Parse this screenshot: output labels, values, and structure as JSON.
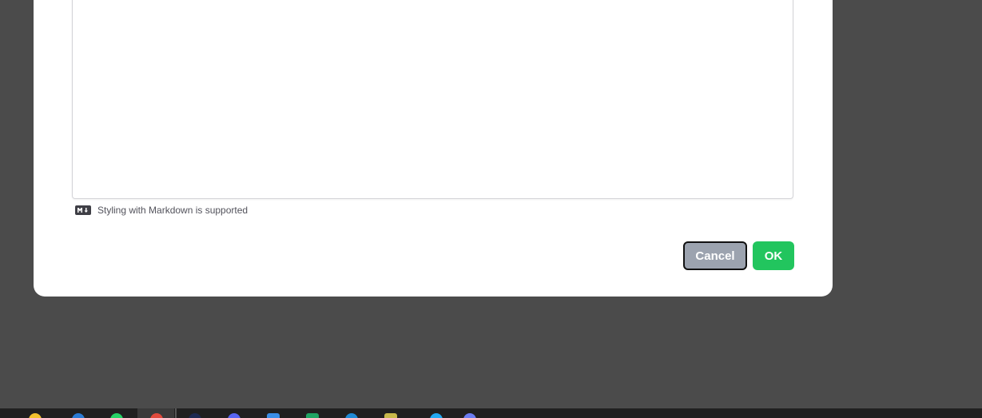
{
  "dialog": {
    "markdown_hint": "Styling with Markdown is supported",
    "cancel_label": "Cancel",
    "ok_label": "OK"
  },
  "colors": {
    "backdrop": "#4b4b4b",
    "cancel_button": "#9ca3af",
    "ok_button": "#22c55e",
    "taskbar": "#202020"
  },
  "taskbar": {
    "icons": [
      {
        "name": "file-explorer-icon",
        "color": "#f2c12e"
      },
      {
        "name": "app-blue-icon",
        "color": "#2b7bd4"
      },
      {
        "name": "whatsapp-icon",
        "color": "#25d366"
      },
      {
        "name": "chrome-icon",
        "color": "#e0493b"
      },
      {
        "name": "app-dark-icon",
        "color": "#1e2a52"
      },
      {
        "name": "discord-icon",
        "color": "#5865f2"
      },
      {
        "name": "calendar-icon",
        "color": "#3a8ee6"
      },
      {
        "name": "sheets-icon",
        "color": "#1fa463"
      },
      {
        "name": "edge-icon",
        "color": "#1e8ad6"
      },
      {
        "name": "notes-icon",
        "color": "#c8b84a"
      },
      {
        "name": "vscode-icon",
        "color": "#23a9f2"
      },
      {
        "name": "app-violet-icon",
        "color": "#6b7cf2"
      }
    ]
  }
}
